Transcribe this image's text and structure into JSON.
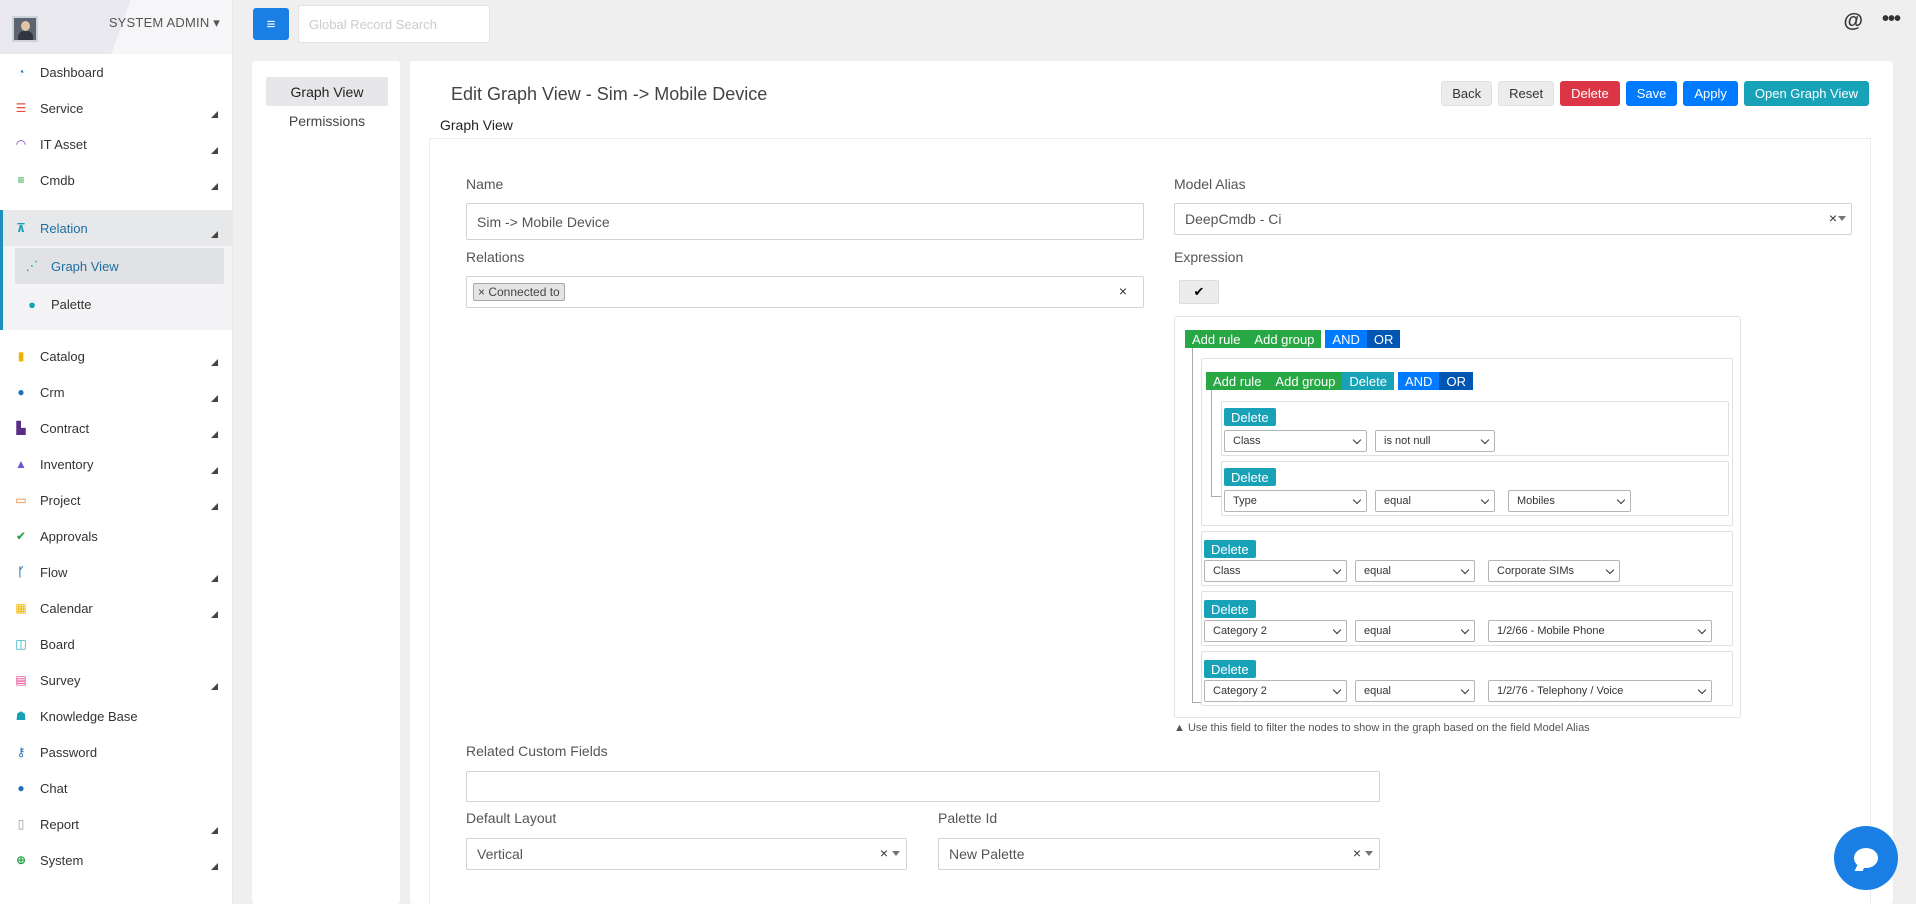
{
  "user": {
    "name": "SYSTEM ADMIN"
  },
  "search": {
    "placeholder": "Global Record Search"
  },
  "sidebar": {
    "items": [
      {
        "label": "Dashboard",
        "icon": "dashboard-icon",
        "color": "#1e8fd8"
      },
      {
        "label": "Service",
        "icon": "service-icon",
        "color": "#e74c3c"
      },
      {
        "label": "IT Asset",
        "icon": "wifi-icon",
        "color": "#7b3fc4"
      },
      {
        "label": "Cmdb",
        "icon": "database-icon",
        "color": "#1a9b3b"
      },
      {
        "label": "Relation",
        "icon": "sitemap-icon",
        "color": "#17a2b8"
      },
      {
        "label": "Catalog",
        "icon": "catalog-icon",
        "color": "#f0b400"
      },
      {
        "label": "Crm",
        "icon": "user-icon",
        "color": "#1e6fb8"
      },
      {
        "label": "Contract",
        "icon": "contract-icon",
        "color": "#5b2c83"
      },
      {
        "label": "Inventory",
        "icon": "warehouse-icon",
        "color": "#6a5acd"
      },
      {
        "label": "Project",
        "icon": "laptop-icon",
        "color": "#e67e22"
      },
      {
        "label": "Approvals",
        "icon": "check-circle-icon",
        "color": "#1a9b3b"
      },
      {
        "label": "Flow",
        "icon": "flow-icon",
        "color": "#1e6fb8"
      },
      {
        "label": "Calendar",
        "icon": "calendar-icon",
        "color": "#f0b400"
      },
      {
        "label": "Board",
        "icon": "board-icon",
        "color": "#17a2b8"
      },
      {
        "label": "Survey",
        "icon": "survey-icon",
        "color": "#e83e8c"
      },
      {
        "label": "Knowledge Base",
        "icon": "knowledge-icon",
        "color": "#17a2b8"
      },
      {
        "label": "Password",
        "icon": "key-icon",
        "color": "#1e6fb8"
      },
      {
        "label": "Chat",
        "icon": "chat-icon",
        "color": "#1e6fb8"
      },
      {
        "label": "Report",
        "icon": "report-icon",
        "color": "#999999"
      },
      {
        "label": "System",
        "icon": "globe-icon",
        "color": "#1a9b3b"
      }
    ],
    "sub": [
      {
        "label": "Graph View",
        "icon": "graph-icon"
      },
      {
        "label": "Palette",
        "icon": "palette-icon"
      }
    ]
  },
  "tabs": {
    "graph_view": "Graph View",
    "permissions": "Permissions"
  },
  "page": {
    "title": "Edit Graph View - Sim -> Mobile Device",
    "subtitle": "Graph View"
  },
  "actions": {
    "back": "Back",
    "reset": "Reset",
    "delete": "Delete",
    "save": "Save",
    "apply": "Apply",
    "open": "Open Graph View"
  },
  "form": {
    "name_label": "Name",
    "name_value": "Sim -> Mobile Device",
    "model_alias_label": "Model Alias",
    "model_alias_value": "DeepCmdb - Ci",
    "relations_label": "Relations",
    "relations_tag": "× Connected to",
    "expression_label": "Expression",
    "expression_help": "▲ Use this field to filter the nodes to show in the graph based on the field Model Alias",
    "related_custom_fields_label": "Related Custom Fields",
    "default_layout_label": "Default Layout",
    "default_layout_value": "Vertical",
    "palette_id_label": "Palette Id",
    "palette_id_value": "New Palette",
    "clear_symbol": "×"
  },
  "qb": {
    "add_rule": "Add rule",
    "add_group": "Add group",
    "delete": "Delete",
    "and": "AND",
    "or": "OR",
    "rules": [
      {
        "field": "Class",
        "op": "is not null",
        "value": ""
      },
      {
        "field": "Type",
        "op": "equal",
        "value": "Mobiles"
      },
      {
        "field": "Class",
        "op": "equal",
        "value": "Corporate SIMs"
      },
      {
        "field": "Category 2",
        "op": "equal",
        "value": "1/2/66 - Mobile Phone"
      },
      {
        "field": "Category 2",
        "op": "equal",
        "value": "1/2/76 - Telephony / Voice"
      }
    ]
  }
}
